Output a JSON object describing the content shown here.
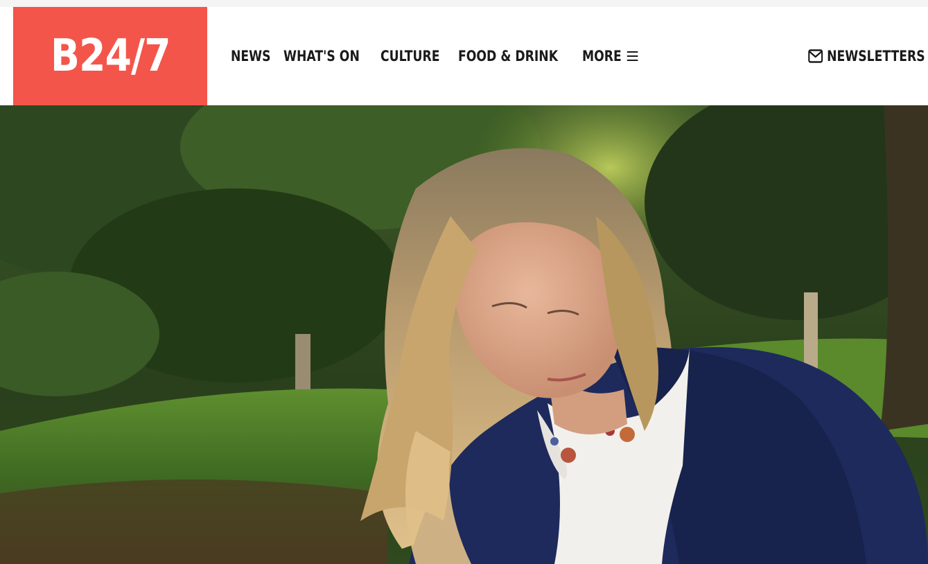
{
  "header": {
    "logo_text": "B24/7",
    "nav": [
      {
        "label": "NEWS"
      },
      {
        "label": "WHAT'S ON"
      },
      {
        "label": "CULTURE"
      },
      {
        "label": "FOOD & DRINK"
      },
      {
        "label": "MORE",
        "icon": "hamburger-menu-icon"
      }
    ],
    "newsletters": {
      "label": "NEWSLETTERS",
      "icon": "envelope-icon"
    }
  },
  "colors": {
    "brand": "#f4554a",
    "nav_text": "#1a1a1a",
    "background": "#ffffff"
  },
  "hero": {
    "image": "photo-woman-in-park"
  }
}
